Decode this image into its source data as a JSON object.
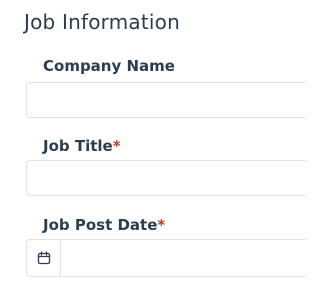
{
  "section": {
    "title": "Job Information"
  },
  "fields": {
    "company_name": {
      "label": "Company Name",
      "value": "",
      "placeholder": ""
    },
    "job_title": {
      "label": "Job Title",
      "required_mark": "*",
      "value": "",
      "placeholder": ""
    },
    "job_post_date": {
      "label": "Job Post Date",
      "required_mark": "*",
      "icon": "calendar-icon"
    }
  },
  "colors": {
    "text": "#2b3d52",
    "border": "#dfe3e8",
    "required": "#c0392b"
  }
}
